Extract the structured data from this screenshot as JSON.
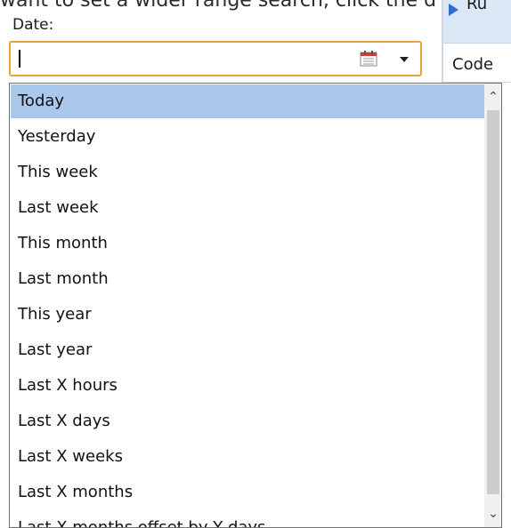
{
  "instruction_text": "want to set a wider range search, click the d",
  "date_label": "Date:",
  "date_value": "",
  "right_header": "Ru",
  "right_code_label": "Code",
  "options": [
    "Today",
    "Yesterday",
    "This week",
    "Last week",
    "This month",
    "Last month",
    "This year",
    "Last year",
    "Last X hours",
    "Last X days",
    "Last X weeks",
    "Last X months",
    "Last X months offset by Y days"
  ],
  "selected_option": "Today",
  "icons": {
    "calendar": "calendar-icon",
    "dropdown": "chevron-down-icon",
    "scroll_up": "scroll-up-icon",
    "scroll_down": "scroll-down-icon",
    "header_arrow": "triangle-right-icon"
  },
  "colors": {
    "input_border": "#e8a33a",
    "selection": "#aac8ec",
    "header_bg": "#dbe9f7"
  }
}
